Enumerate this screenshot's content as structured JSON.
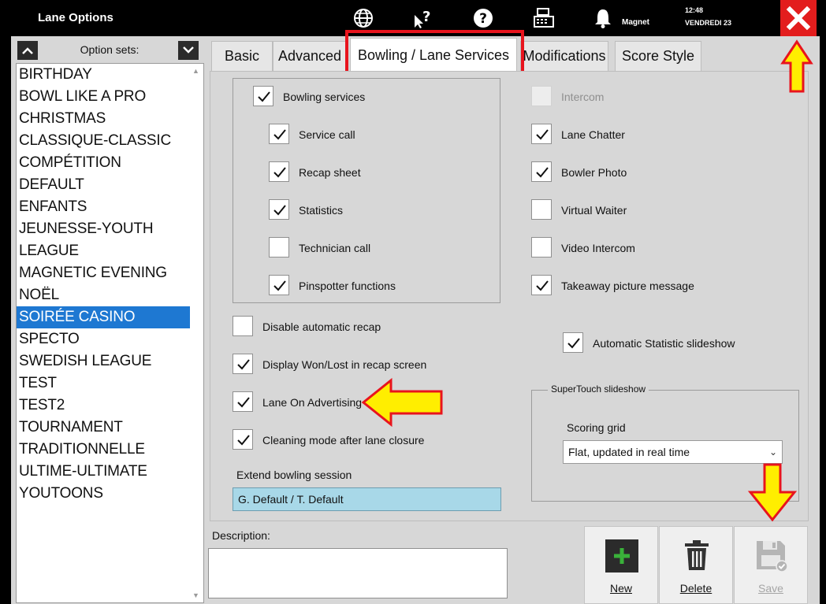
{
  "window": {
    "title": "Lane Options",
    "user": "Magnet",
    "time": "12:48",
    "date": "VENDREDI 23"
  },
  "titlebar_icons": [
    "globe-icon",
    "pointer-help-icon",
    "help-icon",
    "cash-register-icon",
    "bell-icon"
  ],
  "option_sets": {
    "label": "Option sets:",
    "selected": "SOIRÉE CASINO",
    "items": [
      "BIRTHDAY",
      "BOWL LIKE A PRO",
      "CHRISTMAS",
      "CLASSIQUE-CLASSIC",
      "COMPÉTITION",
      "DEFAULT",
      "ENFANTS",
      "JEUNESSE-YOUTH",
      "LEAGUE",
      "MAGNETIC EVENING",
      "NOËL",
      "SOIRÉE CASINO",
      "SPECTO",
      "SWEDISH LEAGUE",
      "TEST",
      "TEST2",
      "TOURNAMENT",
      "TRADITIONNELLE",
      "ULTIME-ULTIMATE",
      "YOUTOONS"
    ]
  },
  "tabs": [
    "Basic",
    "Advanced",
    "Bowling / Lane Services",
    "Modifications",
    "Score Style"
  ],
  "active_tab": "Bowling / Lane Services",
  "bowling_services": {
    "main": {
      "label": "Bowling services",
      "checked": true
    },
    "items": [
      {
        "label": "Service call",
        "checked": true
      },
      {
        "label": "Recap sheet",
        "checked": true
      },
      {
        "label": "Statistics",
        "checked": true
      },
      {
        "label": "Technician call",
        "checked": false
      },
      {
        "label": "Pinspotter functions",
        "checked": true
      }
    ]
  },
  "left_options": [
    {
      "label": "Disable automatic recap",
      "checked": false
    },
    {
      "label": "Display Won/Lost in recap screen",
      "checked": true
    },
    {
      "label": "Lane On Advertising",
      "checked": true
    },
    {
      "label": "Cleaning mode after lane closure",
      "checked": true
    }
  ],
  "extend_session": {
    "label": "Extend bowling session",
    "value": "G. Default / T. Default"
  },
  "right_options": [
    {
      "label": "Intercom",
      "checked": false,
      "disabled": true
    },
    {
      "label": "Lane Chatter",
      "checked": true
    },
    {
      "label": "Bowler Photo",
      "checked": true
    },
    {
      "label": "Virtual Waiter",
      "checked": false
    },
    {
      "label": "Video Intercom",
      "checked": false
    },
    {
      "label": "Takeaway picture message",
      "checked": true
    }
  ],
  "auto_slideshow": {
    "label": "Automatic Statistic slideshow",
    "checked": true
  },
  "supertouch": {
    "title": "SuperTouch slideshow",
    "grid_label": "Scoring grid",
    "grid_value": "Flat, updated in real time"
  },
  "description": {
    "label": "Description:",
    "value": ""
  },
  "actions": {
    "new": "New",
    "delete": "Delete",
    "save": "Save"
  },
  "colors": {
    "close_red": "#e31d1d",
    "selection_blue": "#1e78d2",
    "highlight_red": "#e8141d",
    "arrow_yellow": "#ffee00",
    "field_blue": "#a8d8e8",
    "new_green": "#3ab13a"
  }
}
